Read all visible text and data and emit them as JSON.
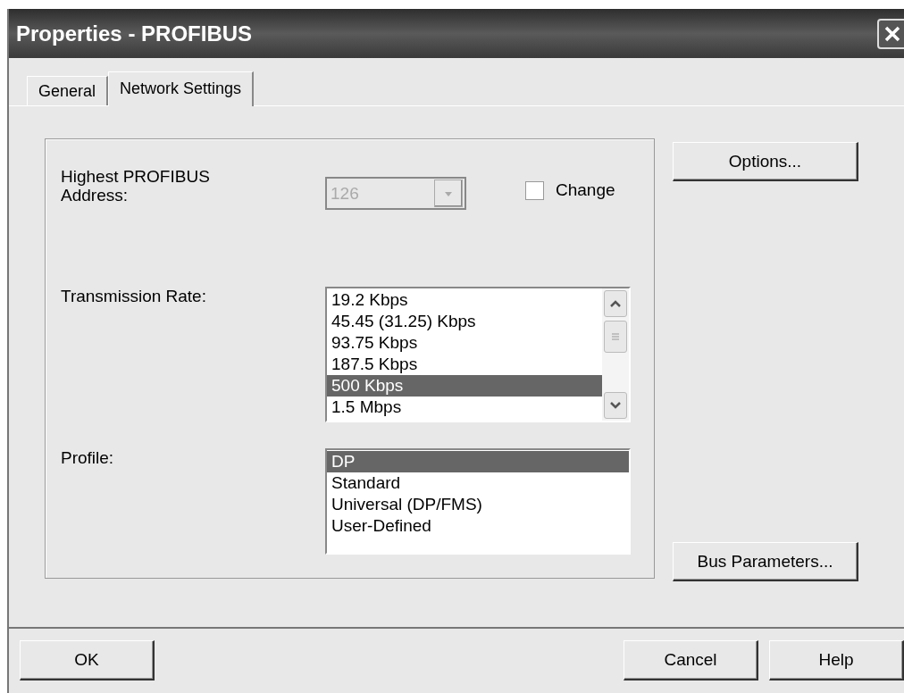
{
  "window": {
    "title": "Properties - PROFIBUS"
  },
  "tabs": [
    {
      "label": "General",
      "selected": false
    },
    {
      "label": "Network Settings",
      "selected": true
    }
  ],
  "address": {
    "label": "Highest PROFIBUS Address:",
    "value": "126",
    "disabled": true
  },
  "change_checkbox": {
    "label": "Change",
    "checked": false
  },
  "transmission_rate": {
    "label": "Transmission Rate:",
    "items": [
      {
        "label": "19.2 Kbps",
        "selected": false
      },
      {
        "label": "45.45 (31.25) Kbps",
        "selected": false
      },
      {
        "label": "93.75 Kbps",
        "selected": false
      },
      {
        "label": "187.5 Kbps",
        "selected": false
      },
      {
        "label": "500 Kbps",
        "selected": true
      },
      {
        "label": "1.5 Mbps",
        "selected": false
      }
    ]
  },
  "profile": {
    "label": "Profile:",
    "items": [
      {
        "label": "DP",
        "selected": true
      },
      {
        "label": "Standard",
        "selected": false
      },
      {
        "label": "Universal (DP/FMS)",
        "selected": false
      },
      {
        "label": "User-Defined",
        "selected": false
      }
    ]
  },
  "side_buttons": [
    "Options...",
    "Bus Parameters..."
  ],
  "footer_buttons": [
    "OK",
    "Cancel",
    "Help"
  ]
}
